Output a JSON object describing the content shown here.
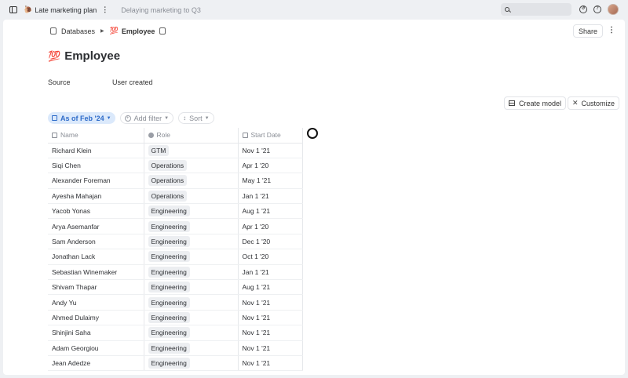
{
  "topbar": {
    "doc_emoji": "🐌",
    "doc_title": "Late marketing plan",
    "subtitle": "Delaying marketing to Q3",
    "search_placeholder": ""
  },
  "breadcrumb": {
    "root": "Databases",
    "current_emoji": "💯",
    "current": "Employee"
  },
  "share_label": "Share",
  "page_title": {
    "emoji": "💯",
    "text": "Employee"
  },
  "properties": {
    "label": "Source",
    "value": "User created"
  },
  "actions": {
    "create_model": "Create model",
    "customize": "Customize"
  },
  "filters": {
    "as_of": "As of Feb '24",
    "add_filter": "Add filter",
    "sort": "Sort"
  },
  "table": {
    "headers": {
      "name": "Name",
      "role": "Role",
      "start": "Start Date"
    },
    "rows": [
      {
        "name": "Richard Klein",
        "role": "GTM",
        "start": "Nov 1 '21"
      },
      {
        "name": "Siqi Chen",
        "role": "Operations",
        "start": "Apr 1 '20"
      },
      {
        "name": "Alexander Foreman",
        "role": "Operations",
        "start": "May 1 '21"
      },
      {
        "name": "Ayesha Mahajan",
        "role": "Operations",
        "start": "Jan 1 '21"
      },
      {
        "name": "Yacob Yonas",
        "role": "Engineering",
        "start": "Aug 1 '21"
      },
      {
        "name": "Arya Asemanfar",
        "role": "Engineering",
        "start": "Apr 1 '20"
      },
      {
        "name": "Sam Anderson",
        "role": "Engineering",
        "start": "Dec 1 '20"
      },
      {
        "name": "Jonathan Lack",
        "role": "Engineering",
        "start": "Oct 1 '20"
      },
      {
        "name": "Sebastian Winemaker",
        "role": "Engineering",
        "start": "Jan 1 '21"
      },
      {
        "name": "Shivam Thapar",
        "role": "Engineering",
        "start": "Aug 1 '21"
      },
      {
        "name": "Andy Yu",
        "role": "Engineering",
        "start": "Nov 1 '21"
      },
      {
        "name": "Ahmed Dulaimy",
        "role": "Engineering",
        "start": "Nov 1 '21"
      },
      {
        "name": "Shinjini Saha",
        "role": "Engineering",
        "start": "Nov 1 '21"
      },
      {
        "name": "Adam Georgiou",
        "role": "Engineering",
        "start": "Nov 1 '21"
      },
      {
        "name": "Jean Adedze",
        "role": "Engineering",
        "start": "Nov 1 '21"
      }
    ]
  }
}
